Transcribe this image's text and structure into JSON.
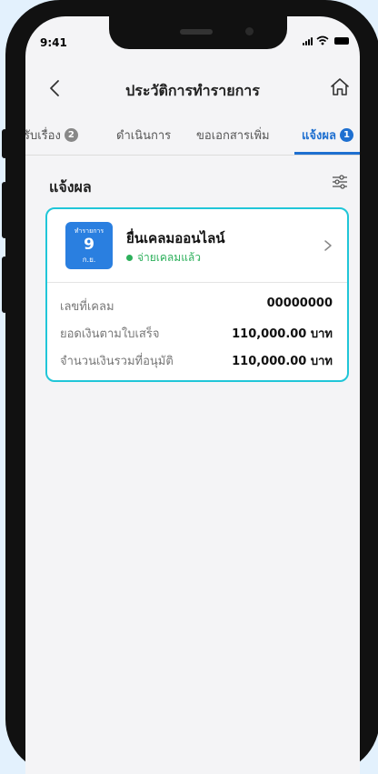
{
  "status": {
    "time": "9:41"
  },
  "header": {
    "title": "ประวัติการทำรายการ"
  },
  "tabs": [
    {
      "label": "รับเรื่อง",
      "badge": "2",
      "active": false
    },
    {
      "label": "ดำเนินการ",
      "badge": "",
      "active": false
    },
    {
      "label": "ขอเอกสารเพิ่ม",
      "badge": "",
      "active": false
    },
    {
      "label": "แจ้งผล",
      "badge": "1",
      "active": true
    }
  ],
  "section": {
    "title": "แจ้งผล"
  },
  "card": {
    "date_label": "ทำรายการ",
    "date_day": "9",
    "date_month": "ก.ย.",
    "name": "ยื่นเคลมออนไลน์",
    "status": "จ่ายเคลมแล้ว",
    "rows": [
      {
        "label": "เลขที่เคลม",
        "value": "00000000"
      },
      {
        "label": "ยอดเงินตามใบเสร็จ",
        "value": "110,000.00 บาท"
      },
      {
        "label": "จำนวนเงินรวมที่อนุมัติ",
        "value": "110,000.00 บาท"
      }
    ]
  },
  "colors": {
    "accent": "#1e6fd0",
    "card_border": "#20c6d8",
    "success": "#2db05b",
    "date_bg": "#2a7fe0"
  }
}
